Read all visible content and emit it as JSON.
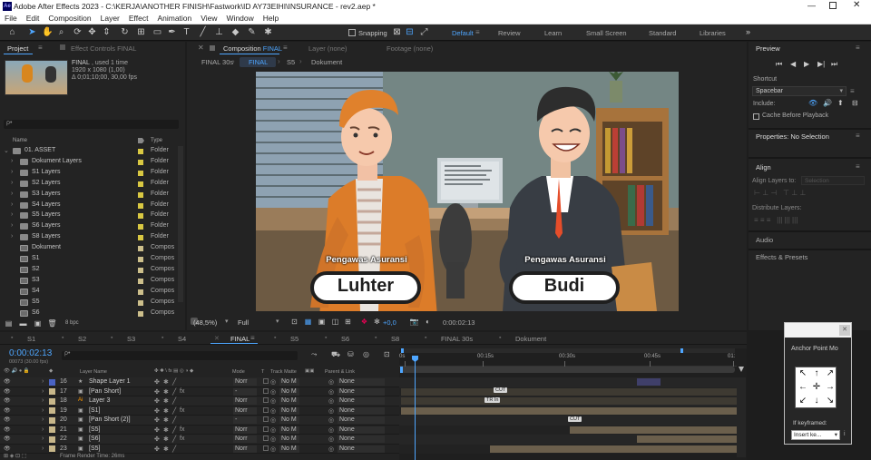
{
  "app": {
    "title": "Adobe After Effects 2023 - C:\\KERJA\\ANOTHER FINISH\\Fastwork\\ID AY73EIHI\\INSURANCE - rev2.aep *",
    "logo": "Ae"
  },
  "menu": [
    "File",
    "Edit",
    "Composition",
    "Layer",
    "Effect",
    "Animation",
    "View",
    "Window",
    "Help"
  ],
  "toolbar": {
    "snapping": "Snapping",
    "workspaces": [
      "Default",
      "Review",
      "Learn",
      "Small Screen",
      "Standard",
      "Libraries"
    ],
    "active_workspace": "Default"
  },
  "project": {
    "tab": "Project",
    "effect_controls": "Effect Controls FINAL",
    "item_name": "FINAL",
    "used": ", used 1 time",
    "dims": "1920 x 1080 (1,00)",
    "duration": "Δ 0;01;10;00, 30,00 fps",
    "search_placeholder": "ρ•",
    "col_name": "Name",
    "col_type": "Type",
    "bpc": "8 bpc",
    "items": [
      {
        "name": "01. ASSET",
        "type": "Folder",
        "indent": 0,
        "kind": "folder",
        "open": true
      },
      {
        "name": "Dokument Layers",
        "type": "Folder",
        "indent": 1,
        "kind": "folder"
      },
      {
        "name": "S1 Layers",
        "type": "Folder",
        "indent": 1,
        "kind": "folder"
      },
      {
        "name": "S2 Layers",
        "type": "Folder",
        "indent": 1,
        "kind": "folder"
      },
      {
        "name": "S3 Layers",
        "type": "Folder",
        "indent": 1,
        "kind": "folder"
      },
      {
        "name": "S4 Layers",
        "type": "Folder",
        "indent": 1,
        "kind": "folder"
      },
      {
        "name": "S5 Layers",
        "type": "Folder",
        "indent": 1,
        "kind": "folder"
      },
      {
        "name": "S6 Layers",
        "type": "Folder",
        "indent": 1,
        "kind": "folder"
      },
      {
        "name": "S8 Layers",
        "type": "Folder",
        "indent": 1,
        "kind": "folder"
      },
      {
        "name": "Dokument",
        "type": "Compos",
        "indent": 1,
        "kind": "comp"
      },
      {
        "name": "S1",
        "type": "Compos",
        "indent": 1,
        "kind": "comp"
      },
      {
        "name": "S2",
        "type": "Compos",
        "indent": 1,
        "kind": "comp"
      },
      {
        "name": "S3",
        "type": "Compos",
        "indent": 1,
        "kind": "comp"
      },
      {
        "name": "S4",
        "type": "Compos",
        "indent": 1,
        "kind": "comp"
      },
      {
        "name": "S5",
        "type": "Compos",
        "indent": 1,
        "kind": "comp"
      },
      {
        "name": "S6",
        "type": "Compos",
        "indent": 1,
        "kind": "comp"
      }
    ]
  },
  "comp_panel": {
    "tab": "Composition",
    "tab_name": "FINAL",
    "layer": "Layer  (none)",
    "footage": "Footage  (none)",
    "breadcrumbs": [
      "FINAL 30s",
      "FINAL",
      "S5",
      "Dokument"
    ],
    "zoom": "(48,5%)",
    "quality": "Full",
    "exposure": "+0,0",
    "timecode": "0:00:02:13",
    "scene": {
      "left_title": "Pengawas Asuransi",
      "left_name": "Luhter",
      "right_title": "Pengawas Asuransi",
      "right_name": "Budi"
    }
  },
  "preview": {
    "tab": "Preview",
    "shortcut_label": "Shortcut",
    "shortcut": "Spacebar",
    "include": "Include:",
    "cache": "Cache Before Playback"
  },
  "properties": {
    "tab": "Properties: No Selection"
  },
  "align": {
    "tab": "Align",
    "align_to": "Align Layers to:",
    "selection": "Selection",
    "distribute": "Distribute Layers:"
  },
  "audio": {
    "tab": "Audio"
  },
  "effects": {
    "tab": "Effects & Presets"
  },
  "floating": {
    "title": "Anchor Point Mo",
    "if_key": "If keyframed:",
    "insert": "Insert ke..."
  },
  "timeline": {
    "timecode": "0:00:02:13",
    "frames": "00073 (30.00 fps)",
    "tabs": [
      "S1",
      "S2",
      "S3",
      "S4",
      "FINAL",
      "S5",
      "S6",
      "S8",
      "FINAL 30s",
      "Dokument"
    ],
    "active_tab": "FINAL",
    "headers": {
      "layer_name": "Layer Name",
      "mode": "Mode",
      "t": "T",
      "track_matte": "Track Matte",
      "parent": "Parent & Link"
    },
    "ruler": [
      "0s",
      "00:15s",
      "00:30s",
      "00:45s",
      "01:"
    ],
    "render_time": "Frame Render Time:  26ms",
    "layers": [
      {
        "num": "16",
        "name": "Shape Layer 1",
        "mode": "Norr",
        "matte": "No M",
        "parent": "None",
        "color": "#4a63c4",
        "kind": "star"
      },
      {
        "num": "17",
        "name": "[Pan Short]",
        "mode": "-",
        "matte": "No M",
        "parent": "None",
        "color": "#c8b78a",
        "kind": "comp",
        "marker": "CUT"
      },
      {
        "num": "18",
        "name": "Layer 3",
        "mode": "Norr",
        "matte": "No M",
        "parent": "None",
        "color": "#c8b78a",
        "kind": "ai",
        "marker": "TR In"
      },
      {
        "num": "19",
        "name": "[S1]",
        "mode": "Norr",
        "matte": "No M",
        "parent": "None",
        "color": "#c8b78a",
        "kind": "comp"
      },
      {
        "num": "20",
        "name": "[Pan Short (2)]",
        "mode": "-",
        "matte": "No M",
        "parent": "None",
        "color": "#c8b78a",
        "kind": "comp",
        "marker": "CUT"
      },
      {
        "num": "21",
        "name": "[S5]",
        "mode": "Norr",
        "matte": "No M",
        "parent": "None",
        "color": "#c8b78a",
        "kind": "comp"
      },
      {
        "num": "22",
        "name": "[S6]",
        "mode": "Norr",
        "matte": "No M",
        "parent": "None",
        "color": "#c8b78a",
        "kind": "comp"
      },
      {
        "num": "23",
        "name": "[S5]",
        "mode": "Norr",
        "matte": "No M",
        "parent": "None",
        "color": "#c8b78a",
        "kind": "comp"
      }
    ]
  }
}
